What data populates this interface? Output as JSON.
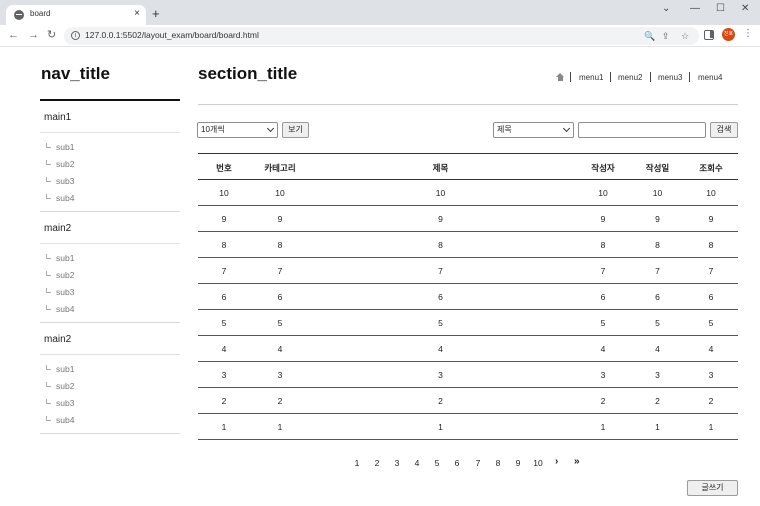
{
  "browser": {
    "tab_title": "board",
    "tab_close": "×",
    "new_tab": "+",
    "url": "127.0.0.1:5502/layout_exam/board/board.html",
    "window_controls": {
      "chevron": "⌄",
      "minimize": "—",
      "maximize": "☐",
      "close": "✕"
    },
    "nav_icons": {
      "back": "←",
      "forward": "→",
      "reload": "↻",
      "zoom": "🔍",
      "share": "⇪",
      "star": "☆",
      "menu": "⋮"
    },
    "profile_initials": "진호",
    "profile_color": "#d9480f"
  },
  "nav": {
    "title": "nav_title",
    "groups": [
      {
        "label": "main1",
        "subs": [
          "sub1",
          "sub2",
          "sub3",
          "sub4"
        ]
      },
      {
        "label": "main2",
        "subs": [
          "sub1",
          "sub2",
          "sub3",
          "sub4"
        ]
      },
      {
        "label": "main2",
        "subs": [
          "sub1",
          "sub2",
          "sub3",
          "sub4"
        ]
      }
    ]
  },
  "section": {
    "title": "section_title",
    "menu": [
      "menu1",
      "menu2",
      "menu3",
      "menu4"
    ],
    "home_icon": "home-icon"
  },
  "controls": {
    "page_size_value": "10개씩",
    "view_button": "보기",
    "search_field_value": "제목",
    "search_input_value": "",
    "search_button": "검색",
    "write_button": "글쓰기"
  },
  "table": {
    "headers": [
      "번호",
      "카테고리",
      "제목",
      "작성자",
      "작성일",
      "조회수"
    ],
    "rows": [
      [
        "10",
        "10",
        "10",
        "10",
        "10",
        "10"
      ],
      [
        "9",
        "9",
        "9",
        "9",
        "9",
        "9"
      ],
      [
        "8",
        "8",
        "8",
        "8",
        "8",
        "8"
      ],
      [
        "7",
        "7",
        "7",
        "7",
        "7",
        "7"
      ],
      [
        "6",
        "6",
        "6",
        "6",
        "6",
        "6"
      ],
      [
        "5",
        "5",
        "5",
        "5",
        "5",
        "5"
      ],
      [
        "4",
        "4",
        "4",
        "4",
        "4",
        "4"
      ],
      [
        "3",
        "3",
        "3",
        "3",
        "3",
        "3"
      ],
      [
        "2",
        "2",
        "2",
        "2",
        "2",
        "2"
      ],
      [
        "1",
        "1",
        "1",
        "1",
        "1",
        "1"
      ]
    ]
  },
  "pagination": {
    "pages": [
      "1",
      "2",
      "3",
      "4",
      "5",
      "6",
      "7",
      "8",
      "9",
      "10"
    ],
    "next": "›",
    "last": "»"
  }
}
